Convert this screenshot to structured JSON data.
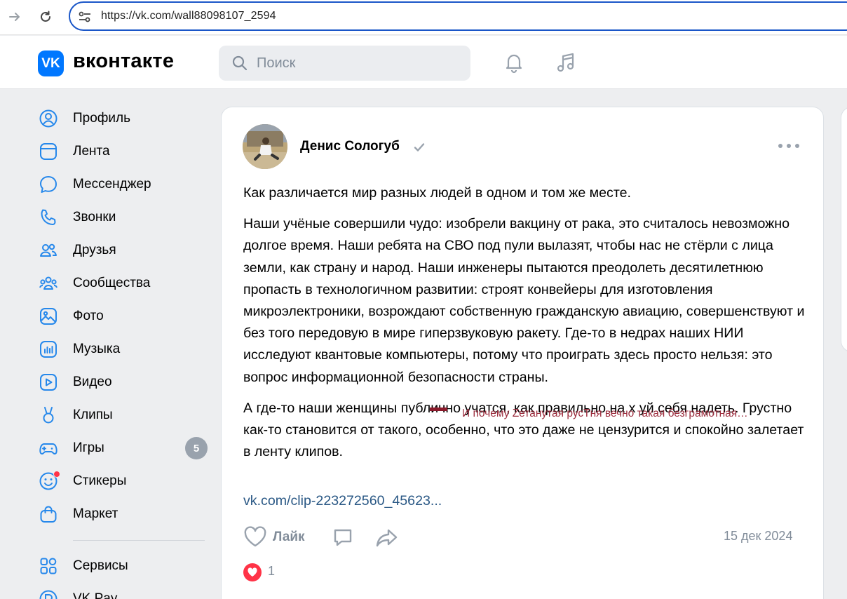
{
  "browser": {
    "url": "https://vk.com/wall88098107_2594"
  },
  "header": {
    "logo_text": "VK",
    "brand": "вконтакте",
    "search_placeholder": "Поиск"
  },
  "sidebar": {
    "items": [
      {
        "label": "Профиль",
        "icon": "profile-icon"
      },
      {
        "label": "Лента",
        "icon": "feed-icon"
      },
      {
        "label": "Мессенджер",
        "icon": "messenger-icon"
      },
      {
        "label": "Звонки",
        "icon": "phone-icon"
      },
      {
        "label": "Друзья",
        "icon": "friends-icon"
      },
      {
        "label": "Сообщества",
        "icon": "communities-icon"
      },
      {
        "label": "Фото",
        "icon": "photo-icon"
      },
      {
        "label": "Музыка",
        "icon": "music-icon"
      },
      {
        "label": "Видео",
        "icon": "video-icon"
      },
      {
        "label": "Клипы",
        "icon": "clips-icon"
      },
      {
        "label": "Игры",
        "icon": "games-icon",
        "badge": "5"
      },
      {
        "label": "Стикеры",
        "icon": "stickers-icon"
      },
      {
        "label": "Маркет",
        "icon": "market-icon"
      }
    ],
    "secondary": [
      {
        "label": "Сервисы",
        "icon": "services-icon"
      },
      {
        "label": "VK Pay",
        "icon": "vkpay-icon"
      }
    ]
  },
  "post": {
    "author": "Денис Сологуб",
    "paragraphs": [
      "Как различается мир разных людей в одном и том же месте.",
      "Наши учёные совершили чудо: изобрели вакцину от рака, это считалось невозможно долгое время. Наши ребята на СВО под пули вылазят, чтобы нас не стёрли с лица земли, как страну и народ. Наши инженеры пытаются преодолеть десятилетнюю пропасть в технологичном развитии: строят конвейеры для изготовления микроэлектроники, возрождают собственную гражданскую авиацию, совершенствуют и без того передовую в мире гиперзвуковую ракету. Где-то в недрах наших НИИ исследуют квантовые компьютеры, потому что проиграть здесь просто нельзя: это вопрос информационной безопасности страны.",
      "А где-то наши женщины публично учатся, как правильно на х уй себя надеть. Грустно как-то становится от такого, особенно, что это даже не цензурится и спокойно залетает в ленту клипов."
    ],
    "overlay_comment": "И почему Zетанутая русТня вечно такая безграмотная…",
    "link": "vk.com/clip-223272560_45623...",
    "like_label": "Лайк",
    "date": "15 дек 2024",
    "reaction_count": "1"
  },
  "colors": {
    "accent": "#0077ff",
    "link": "#2a5885",
    "muted": "#818c99",
    "badge": "#99a2ad",
    "reaction": "#ff3347"
  }
}
